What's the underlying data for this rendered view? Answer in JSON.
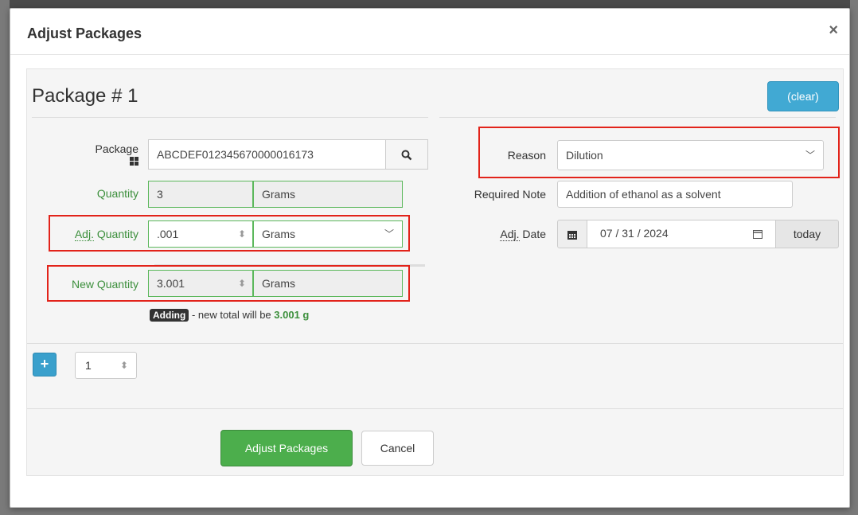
{
  "modal": {
    "title": "Adjust Packages",
    "close": "×"
  },
  "package": {
    "heading": "Package # 1",
    "clear_label": "(clear)",
    "package_label": "Package",
    "package_value": "ABCDEF012345670000016173",
    "quantity_label": "Quantity",
    "quantity_value": "3",
    "quantity_unit": "Grams",
    "adj_quantity_label_part1": "Adj.",
    "adj_quantity_label_part2": " Quantity",
    "adj_quantity_value": ".001",
    "adj_quantity_unit": "Grams",
    "new_quantity_label": "New Quantity",
    "new_quantity_value": "3.001",
    "new_quantity_unit": "Grams",
    "adding_badge": "Adding",
    "hint_text": " - new total will be ",
    "hint_total": "3.001 g",
    "reason_label": "Reason",
    "reason_value": "Dilution",
    "required_note_label": "Required Note",
    "required_note_value": "Addition of ethanol as a solvent",
    "adj_date_label_part1": "Adj.",
    "adj_date_label_part2": " Date",
    "adj_date_value": "07 / 31 / 2024",
    "today_label": "today"
  },
  "footer": {
    "count_value": "1",
    "submit_label": "Adjust Packages",
    "cancel_label": "Cancel"
  },
  "icons": {
    "search": "search-icon",
    "barcode": "barcode-icon",
    "calendar": "calendar-icon",
    "plus": "plus-icon"
  },
  "colors": {
    "primary_blue": "#41a9d3",
    "success_green": "#4cae4c",
    "highlight_red": "#e2231a",
    "label_green": "#3c8f3c"
  }
}
